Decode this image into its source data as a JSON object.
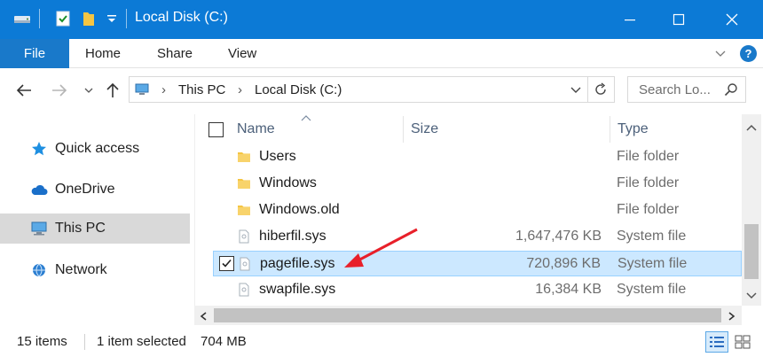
{
  "window": {
    "title": "Local Disk (C:)",
    "accent": "#0c7ad6"
  },
  "ribbon": {
    "tabs": [
      "File",
      "Home",
      "Share",
      "View"
    ]
  },
  "address": {
    "crumbs": [
      "This PC",
      "Local Disk (C:)"
    ],
    "search_placeholder": "Search Lo..."
  },
  "nav_pane": {
    "items": [
      {
        "label": "Quick access",
        "icon": "star-icon"
      },
      {
        "label": "OneDrive",
        "icon": "cloud-icon"
      },
      {
        "label": "This PC",
        "icon": "computer-icon",
        "selected": true
      },
      {
        "label": "Network",
        "icon": "network-icon"
      }
    ]
  },
  "file_list": {
    "columns": [
      "Name",
      "Size",
      "Type"
    ],
    "rows": [
      {
        "name": "Users",
        "size": "",
        "type": "File folder",
        "icon": "folder-icon"
      },
      {
        "name": "Windows",
        "size": "",
        "type": "File folder",
        "icon": "folder-icon"
      },
      {
        "name": "Windows.old",
        "size": "",
        "type": "File folder",
        "icon": "folder-icon"
      },
      {
        "name": "hiberfil.sys",
        "size": "1,647,476 KB",
        "type": "System file",
        "icon": "system-file-icon"
      },
      {
        "name": "pagefile.sys",
        "size": "720,896 KB",
        "type": "System file",
        "icon": "system-file-icon",
        "selected": true
      },
      {
        "name": "swapfile.sys",
        "size": "16,384 KB",
        "type": "System file",
        "icon": "system-file-icon"
      }
    ]
  },
  "status": {
    "item_count": "15 items",
    "selection": "1 item selected",
    "selection_size": "704 MB"
  },
  "annotation": {
    "arrow_color": "#e8202a"
  }
}
